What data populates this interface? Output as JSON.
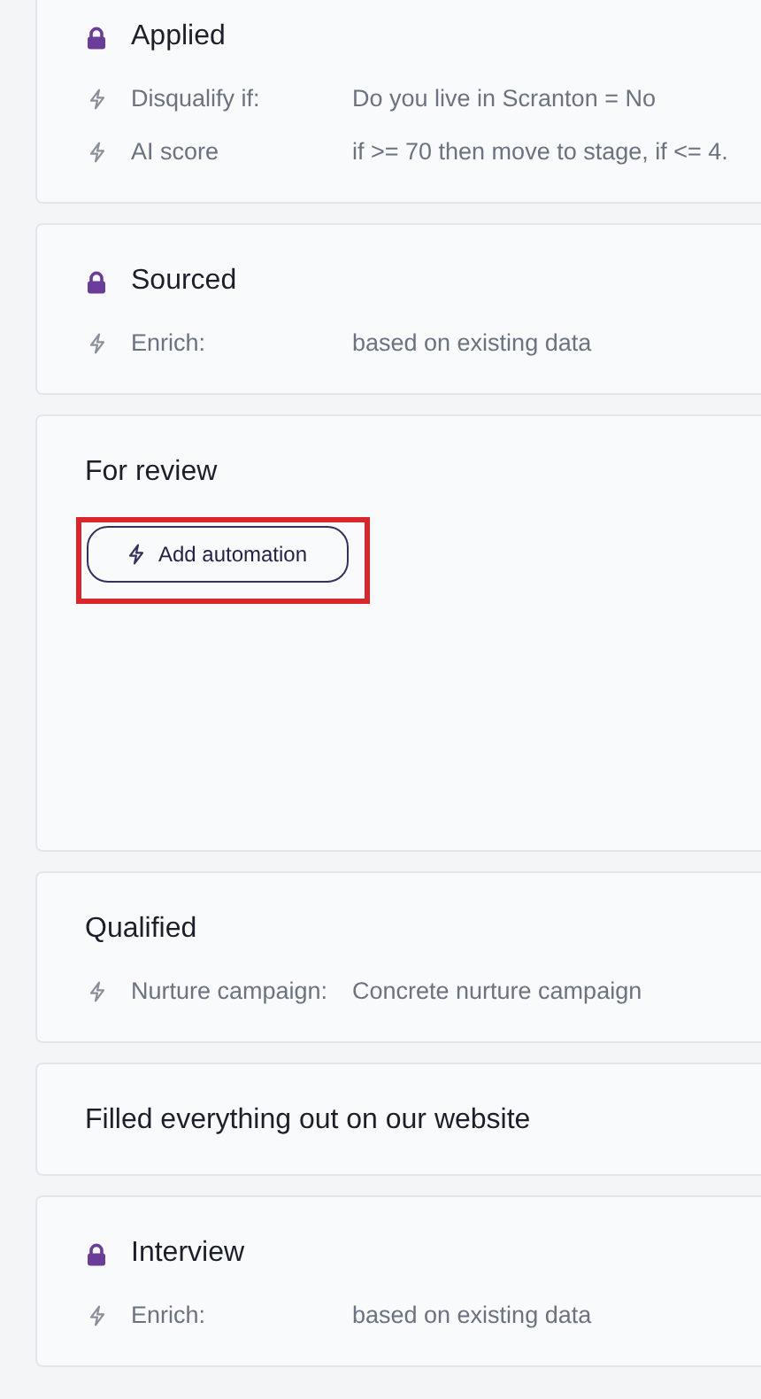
{
  "stages": [
    {
      "title": "Applied",
      "locked": true,
      "automations": [
        {
          "label": "Disqualify if:",
          "value": "Do you live in Scranton = No"
        },
        {
          "label": "AI score",
          "value": "if >= 70 then move to stage, if <= 4."
        }
      ]
    },
    {
      "title": "Sourced",
      "locked": true,
      "automations": [
        {
          "label": "Enrich:",
          "value": "based on existing data"
        }
      ]
    },
    {
      "title": "For review",
      "locked": false,
      "add_button": {
        "label": "Add automation",
        "highlighted": true
      }
    },
    {
      "title": "Qualified",
      "locked": false,
      "automations": [
        {
          "label": "Nurture campaign:",
          "value": "Concrete nurture campaign"
        }
      ]
    },
    {
      "title": "Filled everything out on our website",
      "locked": false
    },
    {
      "title": "Interview",
      "locked": true,
      "automations": [
        {
          "label": "Enrich:",
          "value": "based on existing data"
        }
      ]
    }
  ]
}
